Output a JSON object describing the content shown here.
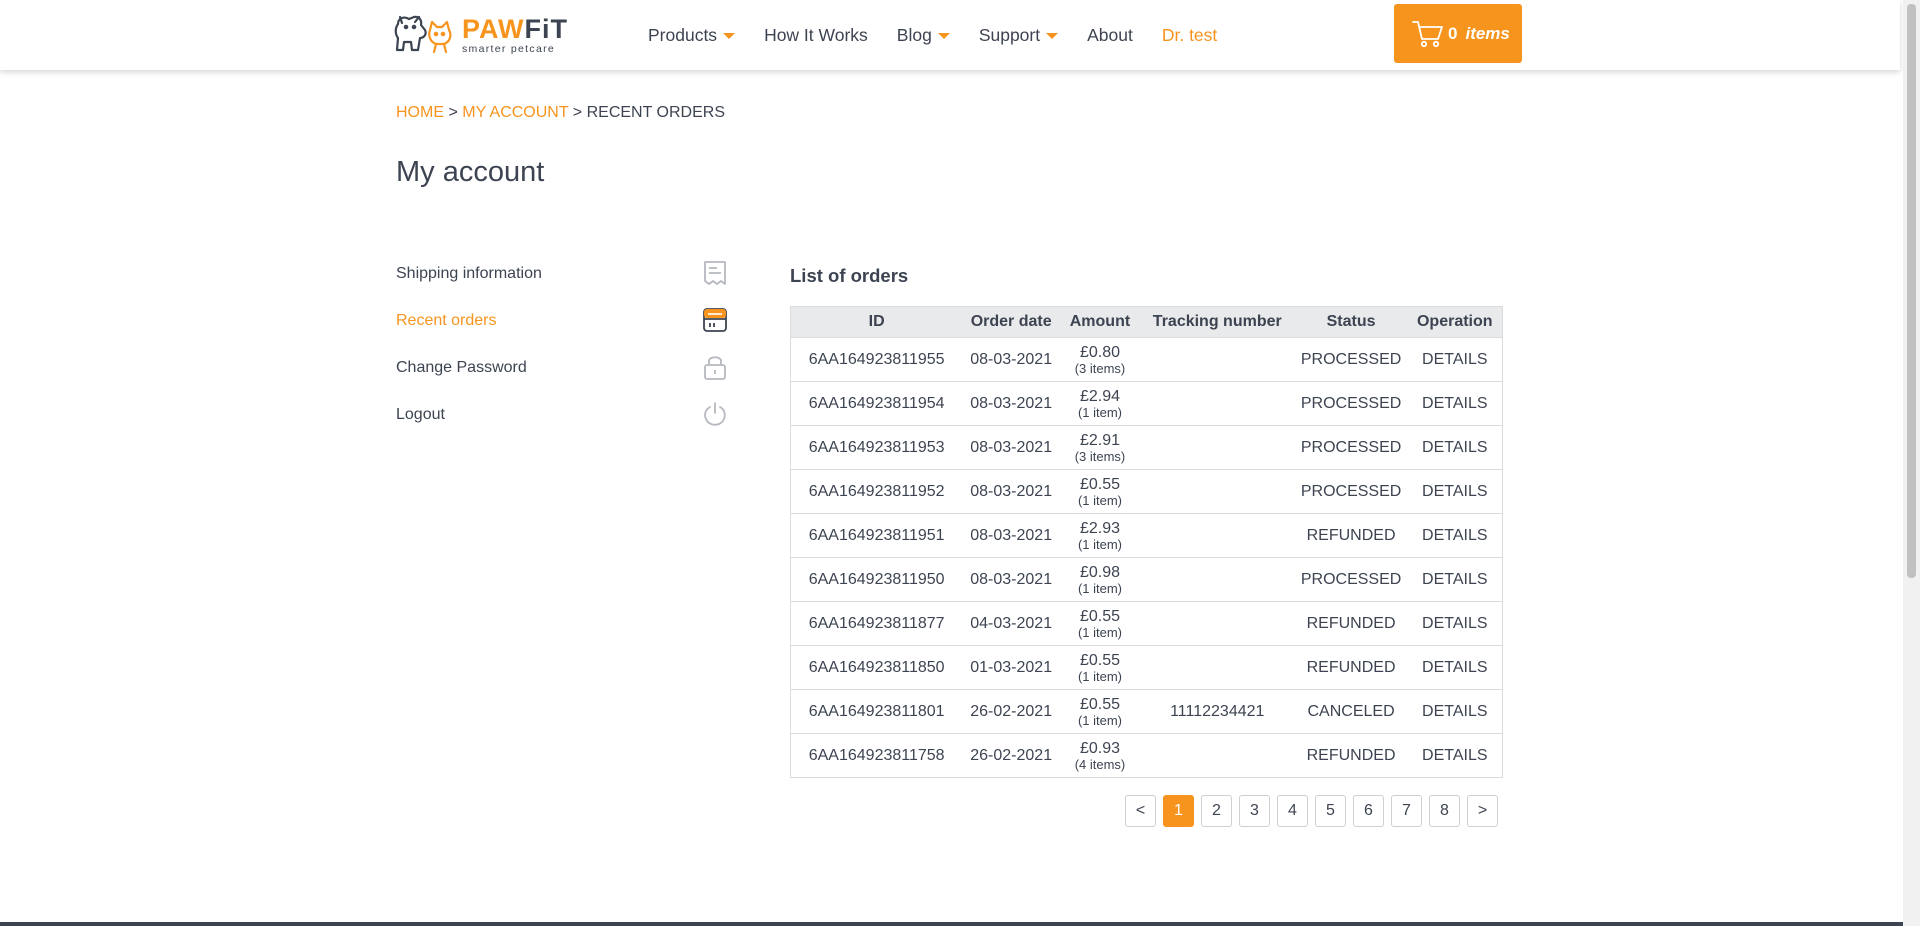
{
  "header": {
    "logo_main_a": "PAW",
    "logo_main_b": "FiT",
    "logo_sub": "smarter petcare",
    "nav": [
      {
        "label": "Products",
        "has_dropdown": true
      },
      {
        "label": "How It Works",
        "has_dropdown": false
      },
      {
        "label": "Blog",
        "has_dropdown": true
      },
      {
        "label": "Support",
        "has_dropdown": true
      },
      {
        "label": "About",
        "has_dropdown": false
      },
      {
        "label": "Dr. test",
        "has_dropdown": false
      }
    ],
    "cart": {
      "count": "0",
      "label": "items",
      "icon": "cart-icon"
    }
  },
  "breadcrumb": {
    "home": "HOME",
    "sep": ">",
    "account": "MY ACCOUNT",
    "current": "RECENT ORDERS"
  },
  "page_title": "My account",
  "sidebar": {
    "items": [
      {
        "label": "Shipping information",
        "icon": "receipt-icon"
      },
      {
        "label": "Recent orders",
        "icon": "orders-box-icon",
        "active": true
      },
      {
        "label": "Change Password",
        "icon": "lock-icon"
      },
      {
        "label": "Logout",
        "icon": "power-icon"
      }
    ]
  },
  "orders": {
    "title": "List of orders",
    "columns": [
      "ID",
      "Order date",
      "Amount",
      "Tracking number",
      "Status",
      "Operation"
    ],
    "rows": [
      {
        "id": "6AA164923811955",
        "date": "08-03-2021",
        "price": "£0.80",
        "qty": "(3 items)",
        "tracking": "",
        "status": "PROCESSED",
        "op": "DETAILS"
      },
      {
        "id": "6AA164923811954",
        "date": "08-03-2021",
        "price": "£2.94",
        "qty": "(1 item)",
        "tracking": "",
        "status": "PROCESSED",
        "op": "DETAILS"
      },
      {
        "id": "6AA164923811953",
        "date": "08-03-2021",
        "price": "£2.91",
        "qty": "(3 items)",
        "tracking": "",
        "status": "PROCESSED",
        "op": "DETAILS"
      },
      {
        "id": "6AA164923811952",
        "date": "08-03-2021",
        "price": "£0.55",
        "qty": "(1 item)",
        "tracking": "",
        "status": "PROCESSED",
        "op": "DETAILS"
      },
      {
        "id": "6AA164923811951",
        "date": "08-03-2021",
        "price": "£2.93",
        "qty": "(1 item)",
        "tracking": "",
        "status": "REFUNDED",
        "op": "DETAILS"
      },
      {
        "id": "6AA164923811950",
        "date": "08-03-2021",
        "price": "£0.98",
        "qty": "(1 item)",
        "tracking": "",
        "status": "PROCESSED",
        "op": "DETAILS"
      },
      {
        "id": "6AA164923811877",
        "date": "04-03-2021",
        "price": "£0.55",
        "qty": "(1 item)",
        "tracking": "",
        "status": "REFUNDED",
        "op": "DETAILS"
      },
      {
        "id": "6AA164923811850",
        "date": "01-03-2021",
        "price": "£0.55",
        "qty": "(1 item)",
        "tracking": "",
        "status": "REFUNDED",
        "op": "DETAILS"
      },
      {
        "id": "6AA164923811801",
        "date": "26-02-2021",
        "price": "£0.55",
        "qty": "(1 item)",
        "tracking": "11112234421",
        "status": "CANCELED",
        "op": "DETAILS"
      },
      {
        "id": "6AA164923811758",
        "date": "26-02-2021",
        "price": "£0.93",
        "qty": "(4 items)",
        "tracking": "",
        "status": "REFUNDED",
        "op": "DETAILS"
      }
    ]
  },
  "pagination": {
    "prev": "<",
    "next": ">",
    "pages": [
      "1",
      "2",
      "3",
      "4",
      "5",
      "6",
      "7",
      "8"
    ],
    "current": "1"
  },
  "colors": {
    "accent": "#f7941d",
    "text": "#3d4451",
    "header_bg": "#e9eaec"
  }
}
